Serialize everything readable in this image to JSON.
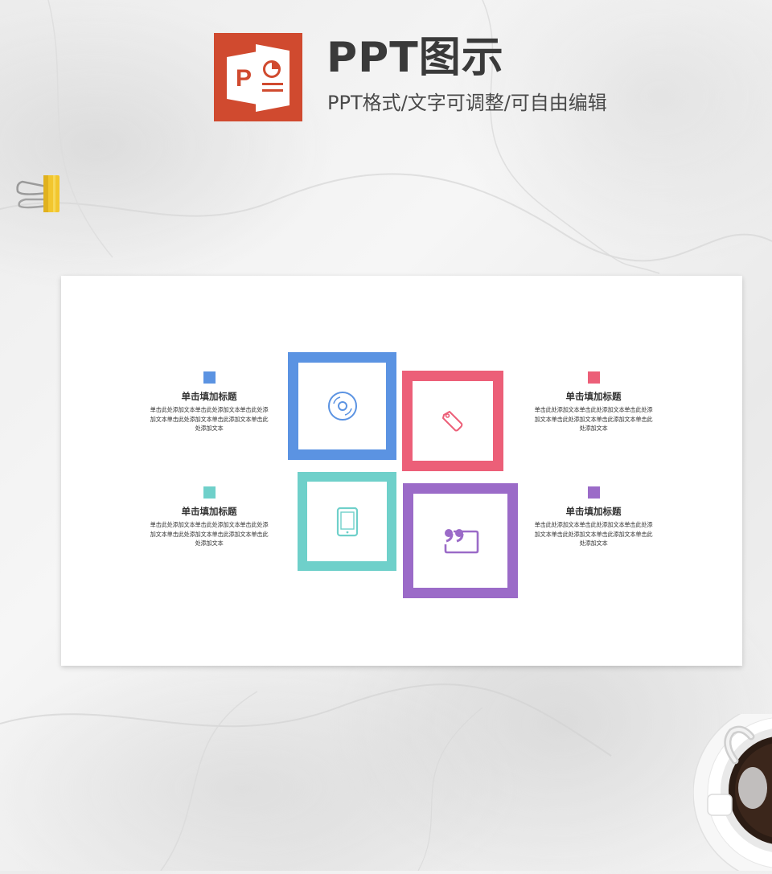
{
  "header": {
    "title": "PPT图示",
    "subtitle": "PPT格式/文字可调整/可自由编辑",
    "logo_letter": "P"
  },
  "colors": {
    "logo": "#d04a2f",
    "blue": "#5b93e2",
    "red": "#ec5f78",
    "teal": "#6fd0ca",
    "purple": "#9b6bc8"
  },
  "slide": {
    "items": [
      {
        "title": "单击填加标题",
        "body": "单击此处添加文本单击此处添加文本单击此处添加文本单击此处添加文本单击此添加文本单击此处添加文本",
        "color": "#5b93e2",
        "icon": "disc-icon"
      },
      {
        "title": "单击填加标题",
        "body": "单击此处添加文本单击此处添加文本单击此处添加文本单击此处添加文本单击此添加文本单击此处添加文本",
        "color": "#ec5f78",
        "icon": "tag-icon"
      },
      {
        "title": "单击填加标题",
        "body": "单击此处添加文本单击此处添加文本单击此处添加文本单击此处添加文本单击此添加文本单击此处添加文本",
        "color": "#6fd0ca",
        "icon": "tablet-icon"
      },
      {
        "title": "单击填加标题",
        "body": "单击此处添加文本单击此处添加文本单击此处添加文本单击此处添加文本单击此添加文本单击此处添加文本",
        "color": "#9b6bc8",
        "icon": "quote-icon"
      }
    ]
  }
}
